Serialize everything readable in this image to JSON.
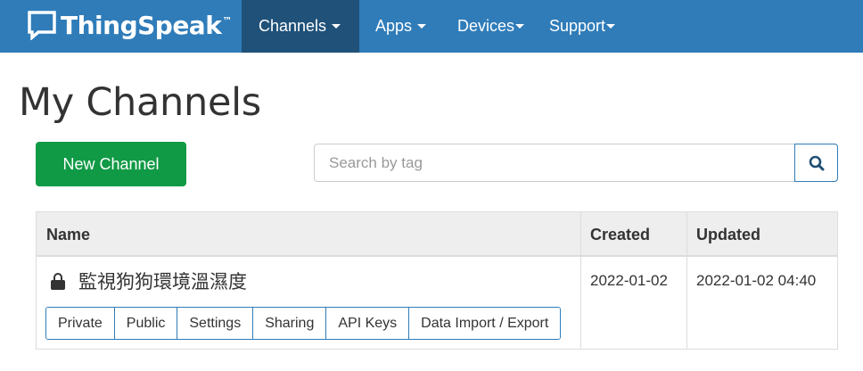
{
  "brand": {
    "name": "ThingSpeak",
    "tm": "™"
  },
  "nav": [
    {
      "label": "Channels"
    },
    {
      "label": "Apps"
    },
    {
      "label": "Devices"
    },
    {
      "label": "Support"
    }
  ],
  "page_title": "My Channels",
  "new_channel_label": "New Channel",
  "search": {
    "placeholder": "Search by tag"
  },
  "table": {
    "headers": {
      "name": "Name",
      "created": "Created",
      "updated": "Updated"
    },
    "rows": [
      {
        "name": "監視狗狗環境溫濕度",
        "created": "2022-01-02",
        "updated": "2022-01-02 04:40",
        "actions": [
          "Private",
          "Public",
          "Settings",
          "Sharing",
          "API Keys",
          "Data Import / Export"
        ]
      }
    ]
  },
  "colors": {
    "navbar": "#2f7cb9",
    "nav_active": "#1f5179",
    "primary_button": "#109a45"
  }
}
